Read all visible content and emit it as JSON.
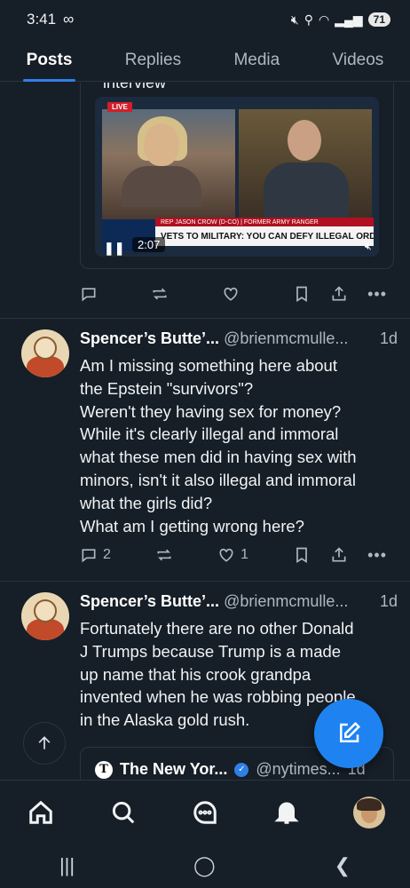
{
  "status_bar": {
    "time": "3:41",
    "voicemail_icon": "voicemail-icon",
    "battery": "71"
  },
  "tabs": [
    {
      "label": "Posts",
      "active": true
    },
    {
      "label": "Replies",
      "active": false
    },
    {
      "label": "Media",
      "active": false
    },
    {
      "label": "Videos",
      "active": false
    }
  ],
  "post0": {
    "embed_text": "interview",
    "video": {
      "live": "LIVE",
      "name_strip": "REP JASON CROW (D-CO) | FORMER ARMY RANGER",
      "lower_third": "VETS TO MILITARY: YOU CAN DEFY ILLEGAL ORDERS",
      "time": "2:07"
    }
  },
  "post1": {
    "author": "Spencer’s Butte’...",
    "handle": "@brienmcmulle...",
    "time": "1d",
    "body_lines": [
      "Am I missing something here about",
      "the Epstein \"survivors\"?",
      "Weren't they having sex for money?",
      "While it's clearly illegal and immoral",
      "what these men did in having sex with",
      "minors, isn't it also illegal and immoral",
      "what the girls did?",
      "What am I getting wrong here?"
    ],
    "reply_count": "2",
    "like_count": "1"
  },
  "post2": {
    "author": "Spencer’s Butte’...",
    "handle": "@brienmcmulle...",
    "time": "1d",
    "body_lines": [
      "Fortunately there are no other Donald",
      "J Trumps because Trump is a made",
      "up name that his crook grandpa",
      "invented when he was robbing people",
      "in the Alaska gold rush."
    ],
    "quote": {
      "logo": "T",
      "author": "The New Yor...",
      "handle": "@nytimes...",
      "time": "1d"
    }
  },
  "colors": {
    "background": "#161e27",
    "accent": "#2f7fe8",
    "fab": "#1e83f0",
    "divider": "#2a3441"
  }
}
